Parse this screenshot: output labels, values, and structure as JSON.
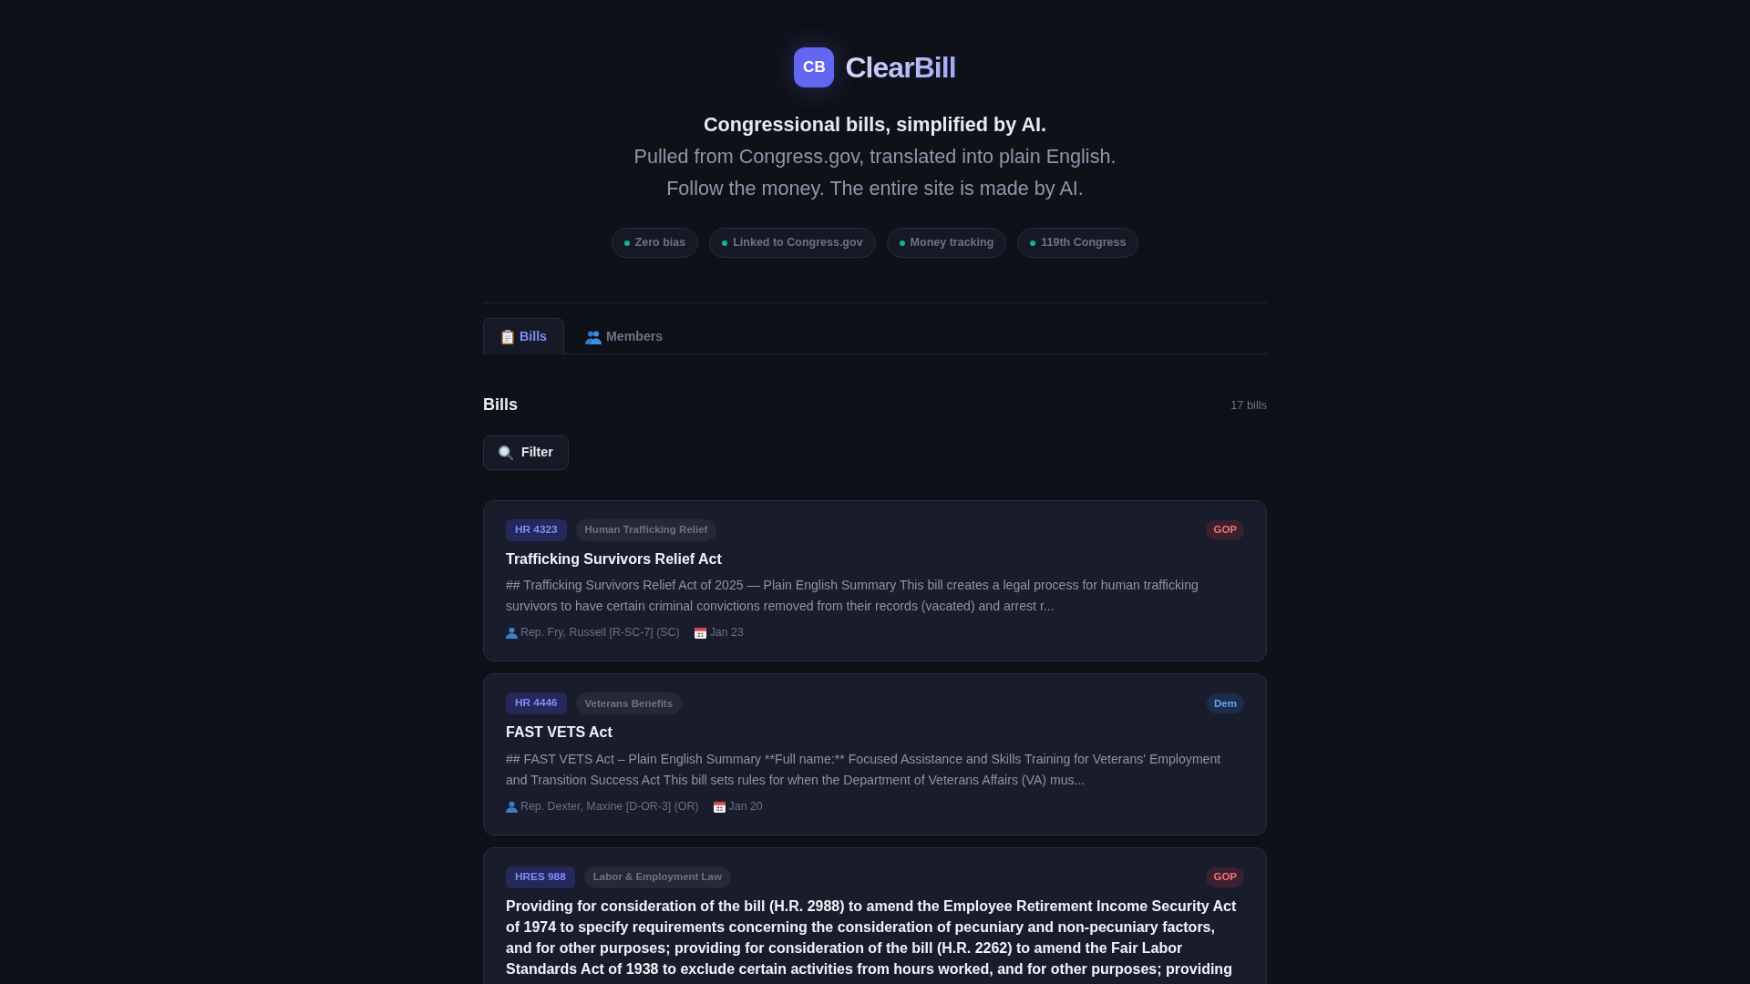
{
  "header": {
    "logo": {
      "mark": "CB",
      "name": "ClearBill"
    },
    "tagline": "Congressional bills, simplified by AI.",
    "description": [
      "Pulled from Congress.gov, translated into plain English.",
      "Follow the money. The entire site is made by AI."
    ],
    "features": [
      "Zero bias",
      "Linked to Congress.gov",
      "Money tracking",
      "119th Congress"
    ]
  },
  "tabs": [
    {
      "label": "Bills",
      "selected": true
    },
    {
      "label": "Members",
      "selected": false
    }
  ],
  "section": {
    "title": "Bills",
    "count": "17 bills"
  },
  "filter": {
    "label": "Filter"
  },
  "bills": [
    {
      "number": "HR 4323",
      "topic": "Human Trafficking Relief",
      "party": {
        "label": "GOP",
        "kind": "gop"
      },
      "title": "Trafficking Survivors Relief Act",
      "summary": "## Trafficking Survivors Relief Act of 2025 — Plain English Summary This bill creates a legal process for human trafficking survivors to have certain criminal convictions removed from their records (vacated) and arrest r...",
      "sponsor": "Rep. Fry, Russell [R-SC-7] (SC)",
      "date": "Jan 23"
    },
    {
      "number": "HR 4446",
      "topic": "Veterans Benefits",
      "party": {
        "label": "Dem",
        "kind": "dem"
      },
      "title": "FAST VETS Act",
      "summary": "## FAST VETS Act – Plain English Summary **Full name:** Focused Assistance and Skills Training for Veterans' Employment and Transition Success Act This bill sets rules for when the Department of Veterans Affairs (VA) mus...",
      "sponsor": "Rep. Dexter, Maxine [D-OR-3] (OR)",
      "date": "Jan 20"
    },
    {
      "number": "HRES 988",
      "topic": "Labor & Employment Law",
      "party": {
        "label": "GOP",
        "kind": "gop"
      },
      "title": "Providing for consideration of the bill (H.R. 2988) to amend the Employee Retirement Income Security Act of 1974 to specify requirements concerning the consideration of pecuniary and non-pecuniary factors, and for other purposes; providing for consideration of the bill (H.R. 2262) to amend the Fair Labor Standards Act of 1938 to exclude certain activities from hours worked, and for other purposes; providing"
    }
  ]
}
